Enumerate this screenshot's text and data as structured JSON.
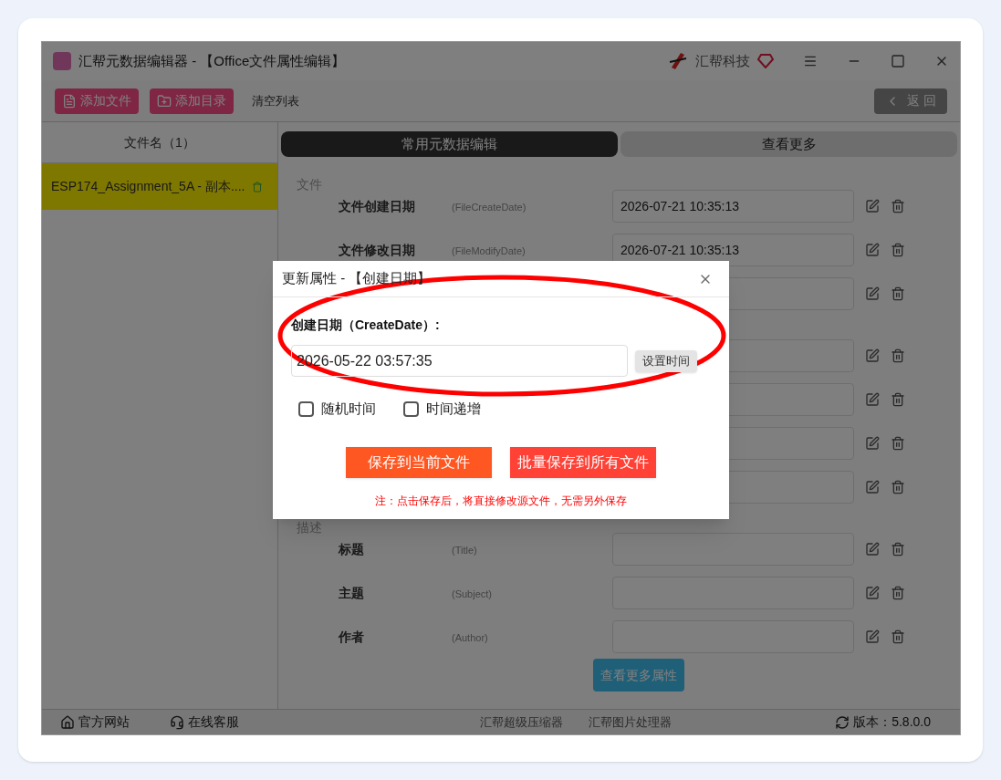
{
  "window": {
    "title": "汇帮元数据编辑器 - 【Office文件属性编辑】",
    "brand": "汇帮科技"
  },
  "toolbar": {
    "buttons": [
      {
        "label": "添加文件",
        "kind": "file"
      },
      {
        "label": "添加目录",
        "kind": "folder"
      },
      {
        "label": "清空列表",
        "kind": "plain"
      }
    ],
    "back": "返 回"
  },
  "file_list": {
    "header": "文件名（1）",
    "items": [
      {
        "name": "ESP174_Assignment_5A - 副本....",
        "selected": true
      }
    ]
  },
  "tabs": [
    {
      "label": "常用元数据编辑",
      "selected": true
    },
    {
      "label": "查看更多",
      "selected": false
    }
  ],
  "sections": [
    {
      "title": "文件",
      "rows": [
        {
          "label": "文件创建日期",
          "key": "(FileCreateDate)",
          "value": "2026-07-21 10:35:13"
        },
        {
          "label": "文件修改日期",
          "key": "(FileModifyDate)",
          "value": "2026-07-21 10:35:13"
        },
        {}
      ]
    },
    {
      "rows": [
        {},
        {},
        {},
        {}
      ]
    },
    {
      "title": "描述",
      "rows": [
        {
          "label": "标题",
          "key": "(Title)"
        },
        {
          "label": "主题",
          "key": "(Subject)"
        },
        {
          "label": "作者",
          "key": "(Author)"
        }
      ]
    }
  ],
  "more_button": "查看更多属性",
  "status_bar": {
    "left": [
      {
        "label": "官方网站",
        "kind": "home"
      },
      {
        "label": "在线客服",
        "kind": "support"
      }
    ],
    "center": [
      "汇帮超级压缩器",
      "汇帮图片处理器"
    ],
    "version": "版本：5.8.0.0"
  },
  "dialog": {
    "title": "更新属性 - 【创建日期】",
    "field_label": "创建日期（CreateDate）:",
    "value": "2026-05-22 03:57:35",
    "set_button": "设置时间",
    "options": [
      {
        "label": "随机时间",
        "checked": false
      },
      {
        "label": "时间递增",
        "checked": false
      }
    ],
    "actions": [
      {
        "label": "保存到当前文件",
        "kind": "primary"
      },
      {
        "label": "批量保存到所有文件",
        "kind": "batch"
      }
    ],
    "note": "注：点击保存后，将直接修改源文件，无需另外保存"
  }
}
